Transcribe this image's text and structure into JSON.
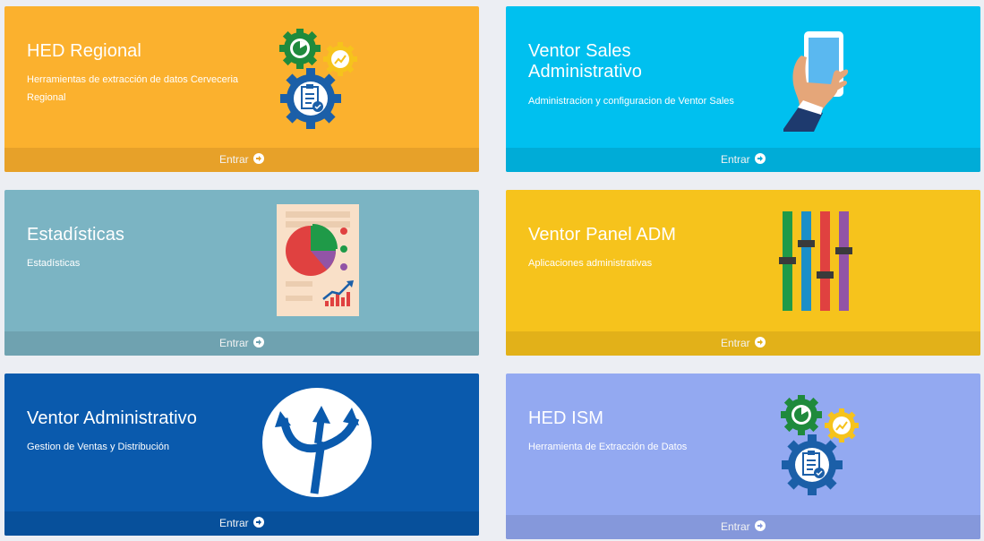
{
  "cards": [
    {
      "title": "HED Regional",
      "desc": "Herramientas de extracción de datos Cerveceria Regional",
      "footer": "Entrar",
      "color": "#fbb12e",
      "footer_color": "#e7a129",
      "icon": "gears-clipboard-icon"
    },
    {
      "title": "Ventor Sales Administrativo",
      "desc": "Administracion y configuracion de Ventor Sales",
      "footer": "Entrar",
      "color": "#00c0ef",
      "footer_color": "#00acd7",
      "icon": "hand-phone-icon"
    },
    {
      "title": "Estadísticas",
      "desc": "Estadísticas",
      "footer": "Entrar",
      "color": "#7bb4c3",
      "footer_color": "#6fa2b0",
      "icon": "report-chart-icon"
    },
    {
      "title": "Ventor Panel ADM",
      "desc": "Aplicaciones administrativas",
      "footer": "Entrar",
      "color": "#f6c31c",
      "footer_color": "#e2b119",
      "icon": "sliders-icon"
    },
    {
      "title": "Ventor Administrativo",
      "desc": "Gestion de Ventas y Distribución",
      "footer": "Entrar",
      "color": "#0a5aad",
      "footer_color": "#07509b",
      "icon": "trident-logo-icon"
    },
    {
      "title": "HED ISM",
      "desc": "Herramienta de Extracción de Datos",
      "footer": "Entrar",
      "color": "#93a9f1",
      "footer_color": "#8598db",
      "icon": "gears-clipboard-icon"
    }
  ]
}
